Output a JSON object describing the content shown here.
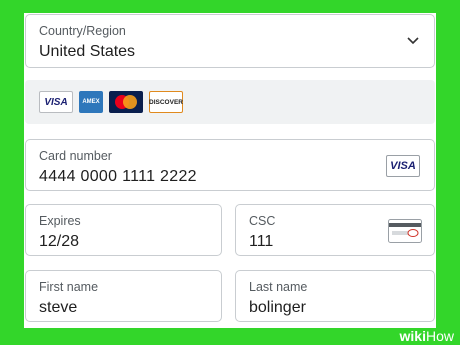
{
  "country": {
    "label": "Country/Region",
    "value": "United States",
    "icon": "chevron-down-icon"
  },
  "accepted_cards": [
    {
      "name": "VISA",
      "icon": "visa-icon"
    },
    {
      "name": "AMEX",
      "icon": "amex-icon"
    },
    {
      "name": "MasterCard",
      "icon": "mastercard-icon"
    },
    {
      "name": "DISCOVER",
      "icon": "discover-icon"
    }
  ],
  "card_number": {
    "label": "Card number",
    "value": "4444 0000 1111 2222",
    "brand": "VISA"
  },
  "expires": {
    "label": "Expires",
    "value": "12/28"
  },
  "csc": {
    "label": "CSC",
    "value": "111",
    "icon": "card-back-csc-icon"
  },
  "first_name": {
    "label": "First name",
    "value": "steve"
  },
  "last_name": {
    "label": "Last name",
    "value": "bolinger"
  },
  "watermark": {
    "wiki": "wiki",
    "how": "How"
  },
  "colors": {
    "frame": "#33d62a",
    "field_border": "#c9cdd1",
    "cards_bg": "#f0f2f3"
  }
}
